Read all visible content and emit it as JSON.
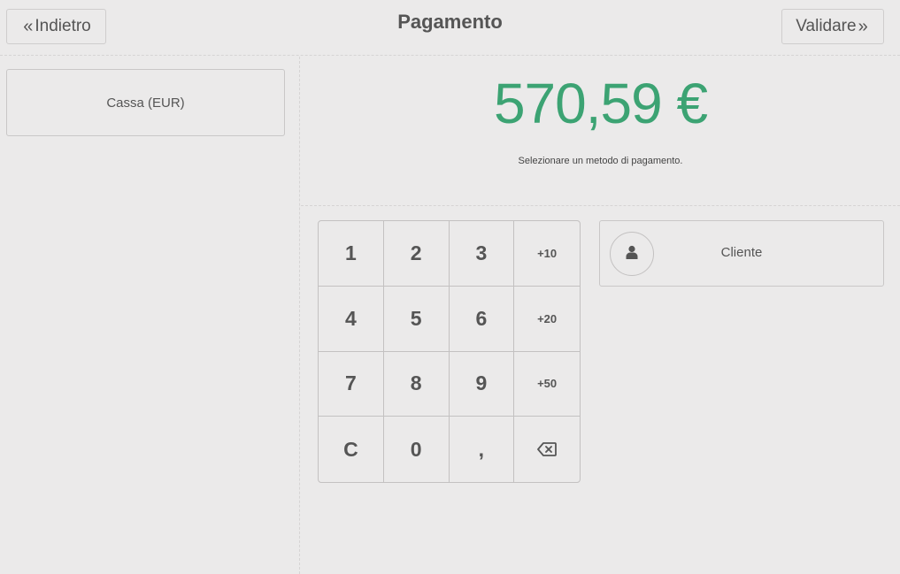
{
  "header": {
    "back_label": "Indietro",
    "title": "Pagamento",
    "validate_label": "Validare"
  },
  "payment_methods": [
    {
      "label": "Cassa (EUR)"
    }
  ],
  "payment": {
    "amount": "570,59 €",
    "hint": "Selezionare un metodo di pagamento."
  },
  "numpad": {
    "keys": [
      "1",
      "2",
      "3",
      "+10",
      "4",
      "5",
      "6",
      "+20",
      "7",
      "8",
      "9",
      "+50",
      "C",
      "0",
      ",",
      "backspace-icon"
    ]
  },
  "customer": {
    "label": "Cliente",
    "icon": "user-icon"
  },
  "colors": {
    "background": "#ebeaea",
    "amount": "#3ca373",
    "text": "#555555"
  }
}
